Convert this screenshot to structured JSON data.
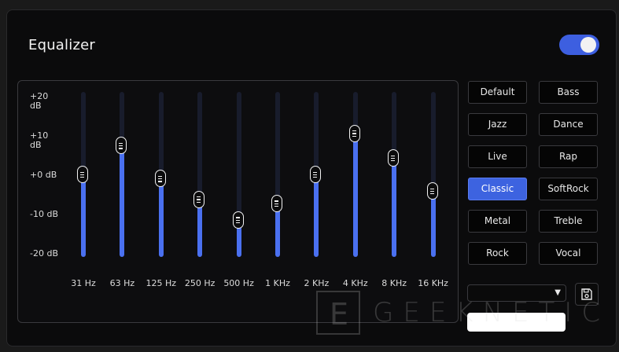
{
  "header": {
    "title": "Equalizer",
    "enabled": true
  },
  "scale": {
    "max_db": 20,
    "min_db": -20,
    "labels": [
      "+20 dB",
      "+10 dB",
      "+0 dB",
      "-10 dB",
      "-20 dB"
    ]
  },
  "bands": [
    {
      "freq": "31 Hz",
      "gain_db": 0
    },
    {
      "freq": "63 Hz",
      "gain_db": 7
    },
    {
      "freq": "125 Hz",
      "gain_db": -1
    },
    {
      "freq": "250 Hz",
      "gain_db": -6
    },
    {
      "freq": "500 Hz",
      "gain_db": -11
    },
    {
      "freq": "1 KHz",
      "gain_db": -7
    },
    {
      "freq": "2 KHz",
      "gain_db": 0
    },
    {
      "freq": "4 KHz",
      "gain_db": 10
    },
    {
      "freq": "8 KHz",
      "gain_db": 4
    },
    {
      "freq": "16 KHz",
      "gain_db": -4
    }
  ],
  "presets": {
    "selected": "Classic",
    "items": [
      "Default",
      "Bass",
      "Jazz",
      "Dance",
      "Live",
      "Rap",
      "Classic",
      "SoftRock",
      "Metal",
      "Treble",
      "Rock",
      "Vocal"
    ]
  },
  "custom": {
    "select_value": "",
    "name_value": ""
  },
  "watermark": {
    "logo": "E",
    "text": "GEEKNETIC"
  },
  "colors": {
    "accent": "#3d63e0",
    "fill": "#4a70f0",
    "track": "#181c2c"
  }
}
